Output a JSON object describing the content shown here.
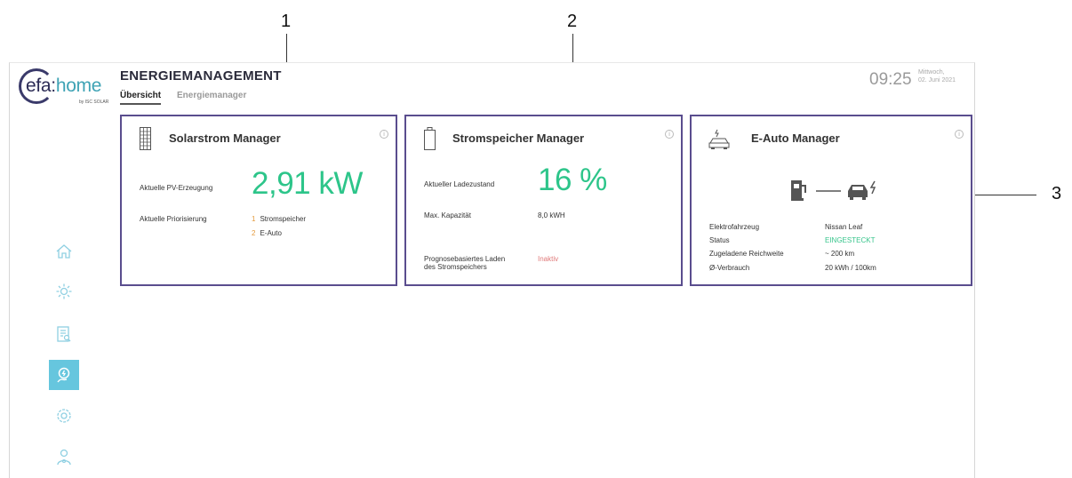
{
  "callouts": [
    "1",
    "2",
    "3"
  ],
  "logo": {
    "prefix": "efa",
    "separator": ":",
    "suffix": "home",
    "subtitle": "by ISC SOLAR"
  },
  "header": {
    "title": "ENERGIEMANAGEMENT",
    "tabs": [
      {
        "label": "Übersicht",
        "active": true
      },
      {
        "label": "Energiemanager",
        "active": false
      }
    ],
    "time": "09:25",
    "weekday": "Mittwoch,",
    "date": "02. Juni 2021"
  },
  "sidebar": {
    "items": [
      {
        "icon": "home-icon",
        "active": false
      },
      {
        "icon": "sun-icon",
        "active": false
      },
      {
        "icon": "report-icon",
        "active": false
      },
      {
        "icon": "energy-manager-icon",
        "active": true
      },
      {
        "icon": "gear-icon",
        "active": false
      },
      {
        "icon": "user-icon",
        "active": false
      }
    ]
  },
  "cards": {
    "solar": {
      "title": "Solarstrom Manager",
      "pv_label": "Aktuelle PV-Erzeugung",
      "pv_value": "2,91 kW",
      "priority_label": "Aktuelle Priorisierung",
      "priorities": [
        {
          "num": "1",
          "name": "Stromspeicher"
        },
        {
          "num": "2",
          "name": "E-Auto"
        }
      ]
    },
    "storage": {
      "title": "Stromspeicher Manager",
      "soc_label": "Aktueller Ladezustand",
      "soc_value": "16 %",
      "capacity_label": "Max. Kapazität",
      "capacity_value": "8,0 kWH",
      "forecast_label_1": "Prognosebasiertes Laden",
      "forecast_label_2": "des Stromspeichers",
      "forecast_value": "Inaktiv"
    },
    "ev": {
      "title": "E-Auto Manager",
      "rows": [
        {
          "label": "Elektrofahrzeug",
          "value": "Nissan Leaf"
        },
        {
          "label": "Status",
          "value": "EINGESTECKT"
        },
        {
          "label": "Zugeladene Reichweite",
          "value": "~ 200 km"
        },
        {
          "label": "Ø-Verbrauch",
          "value": "20 kWh / 100km"
        }
      ]
    }
  },
  "colors": {
    "accent_green": "#2dc58a",
    "card_border": "#5a4d8e",
    "sidebar_icon": "#8fd0e2",
    "sidebar_active": "#66c6de",
    "inactive_red": "#e07a7a",
    "priority_orange": "#e49a3c"
  }
}
